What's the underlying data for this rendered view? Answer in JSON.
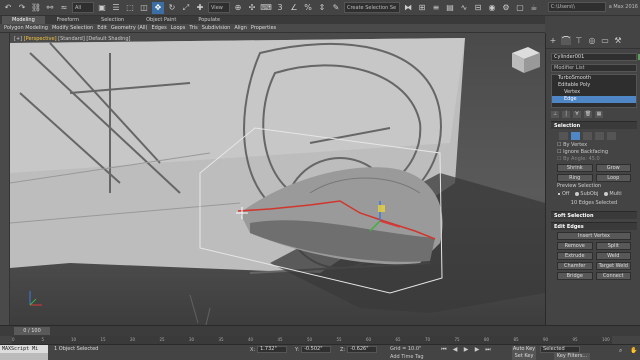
{
  "toolbar": {
    "all_filter": "All",
    "view_dropdown": "View",
    "selection_set": "Create Selection Se",
    "project_path": "C:\\Users\\\\",
    "app_name": "a Max 2016"
  },
  "ribbon": {
    "tabs": [
      "Modeling",
      "Freeform",
      "Selection",
      "Object Paint",
      "Populate"
    ],
    "active_tab": "Modeling",
    "commands": [
      "Polygon Modeling",
      "Modify Selection",
      "Edit",
      "Geometry (All)",
      "Edges",
      "Loops",
      "Tris",
      "Subdivision",
      "Align",
      "Properties"
    ]
  },
  "viewport": {
    "label_parts": [
      "[+]",
      "[Perspective]",
      "[Standard]",
      "[Default Shading]"
    ]
  },
  "command_panel": {
    "object_name": "Cylinder001",
    "modifier_list": "Modifier List",
    "object_color": "#5e9e5e",
    "stack": [
      {
        "label": "TurboSmooth",
        "indent": 0,
        "selected": false
      },
      {
        "label": "Editable Poly",
        "indent": 0,
        "selected": false
      },
      {
        "label": "Vertex",
        "indent": 1,
        "selected": false
      },
      {
        "label": "Edge",
        "indent": 1,
        "selected": true
      }
    ],
    "selection": {
      "title": "Selection",
      "by_vertex": "By Vertex",
      "ignore_backfacing": "Ignore Backfacing",
      "by_angle": "By Angle:",
      "by_angle_value": "45.0",
      "shrink": "Shrink",
      "grow": "Grow",
      "ring": "Ring",
      "loop": "Loop",
      "preview_selection": "Preview Selection",
      "preview_off": "Off",
      "preview_subobj": "SubObj",
      "preview_multi": "Multi",
      "status": "10 Edges Selected"
    },
    "soft_selection_title": "Soft Selection",
    "edit_edges": {
      "title": "Edit Edges",
      "insert_vertex": "Insert Vertex",
      "remove": "Remove",
      "split": "Split",
      "extrude": "Extrude",
      "weld": "Weld",
      "chamfer": "Chamfer",
      "target_weld": "Target Weld",
      "bridge": "Bridge",
      "connect": "Connect"
    }
  },
  "timeline": {
    "frame_display": "0 / 100",
    "ruler_ticks": [
      "0",
      "5",
      "10",
      "15",
      "20",
      "25",
      "30",
      "35",
      "40",
      "45",
      "50",
      "55",
      "60",
      "65",
      "70",
      "75",
      "80",
      "85",
      "90",
      "95",
      "100"
    ]
  },
  "status": {
    "maxscript": "MAXScript Mi",
    "objects_selected": "1 Object Selected",
    "hint": "",
    "x_label": "X:",
    "x_value": "1.732\"",
    "y_label": "Y:",
    "y_value": "-0.502\"",
    "z_label": "Z:",
    "z_value": "-0.626\"",
    "grid": "Grid = 10.0\"",
    "add_time_tag": "Add Time Tag",
    "auto_key": "Auto Key",
    "set_key": "Set Key",
    "selected_dropdown": "Selected",
    "key_filters": "Key Filters..."
  }
}
